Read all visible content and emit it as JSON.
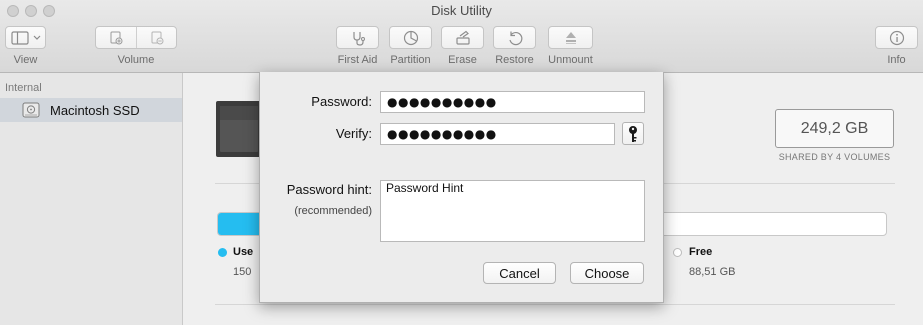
{
  "window": {
    "title": "Disk Utility"
  },
  "toolbar": {
    "view_label": "View",
    "volume_label": "Volume",
    "first_aid_label": "First Aid",
    "partition_label": "Partition",
    "erase_label": "Erase",
    "restore_label": "Restore",
    "unmount_label": "Unmount",
    "info_label": "Info"
  },
  "sidebar": {
    "section": "Internal",
    "items": [
      {
        "label": "Macintosh SSD",
        "selected": true,
        "icon": "internal-disk-icon"
      }
    ]
  },
  "disk": {
    "capacity": "249,2 GB",
    "capacity_note": "SHARED BY 4 VOLUMES",
    "used_fraction": 0.645,
    "legend": [
      {
        "name": "Use",
        "value": "150",
        "color": "#25bdf0"
      },
      {
        "name": "Free",
        "value": "88,51 GB",
        "color": "#ffffff"
      }
    ]
  },
  "dialog": {
    "password_label": "Password:",
    "password_value": "●●●●●●●●●●",
    "verify_label": "Verify:",
    "verify_value": "●●●●●●●●●●",
    "hint_label": "Password hint:",
    "hint_sub": "(recommended)",
    "hint_value": "Password Hint",
    "cancel_label": "Cancel",
    "choose_label": "Choose"
  },
  "colors": {
    "accent": "#25bdf0",
    "selection": "#d1d6dc"
  }
}
